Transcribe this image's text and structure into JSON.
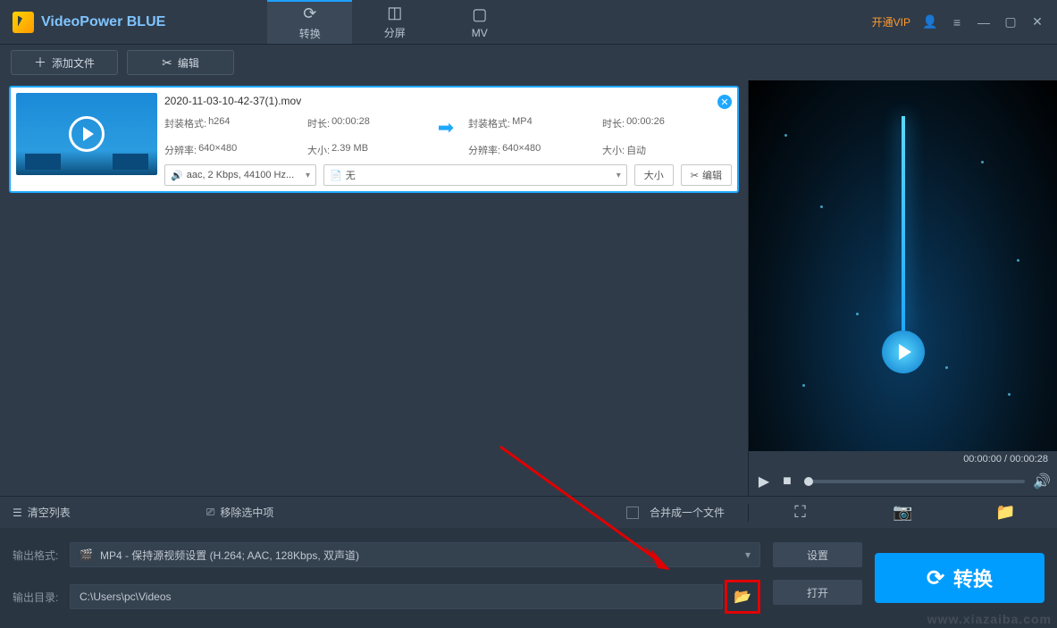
{
  "app": {
    "title": "VideoPower BLUE",
    "vip": "开通VIP"
  },
  "nav": {
    "convert": "转换",
    "split": "分屏",
    "mv": "MV"
  },
  "toolbar": {
    "add_file": "添加文件",
    "edit": "编辑"
  },
  "item": {
    "filename": "2020-11-03-10-42-37(1).mov",
    "src": {
      "format_label": "封装格式:",
      "format": "h264",
      "duration_label": "时长:",
      "duration": "00:00:28",
      "resolution_label": "分辨率:",
      "resolution": "640×480",
      "size_label": "大小:",
      "size": "2.39 MB"
    },
    "dst": {
      "format_label": "封装格式:",
      "format": "MP4",
      "duration_label": "时长:",
      "duration": "00:00:26",
      "resolution_label": "分辨率:",
      "resolution": "640×480",
      "size_label": "大小:",
      "size": "自动"
    },
    "audio_select": "aac, 2 Kbps, 44100 Hz...",
    "subtitle_select": "无",
    "size_btn": "大小",
    "edit_btn": "编辑"
  },
  "preview": {
    "time": "00:00:00 / 00:00:28"
  },
  "footer1": {
    "clear": "清空列表",
    "remove_selected": "移除选中项",
    "merge": "合并成一个文件"
  },
  "output": {
    "format_label": "输出格式:",
    "format_value": "MP4 - 保持源视频设置 (H.264; AAC, 128Kbps, 双声道)",
    "dir_label": "输出目录:",
    "dir_value": "C:\\Users\\pc\\Videos",
    "settings": "设置",
    "open": "打开",
    "convert": "转换"
  },
  "watermark": "www.xiazaiba.com"
}
